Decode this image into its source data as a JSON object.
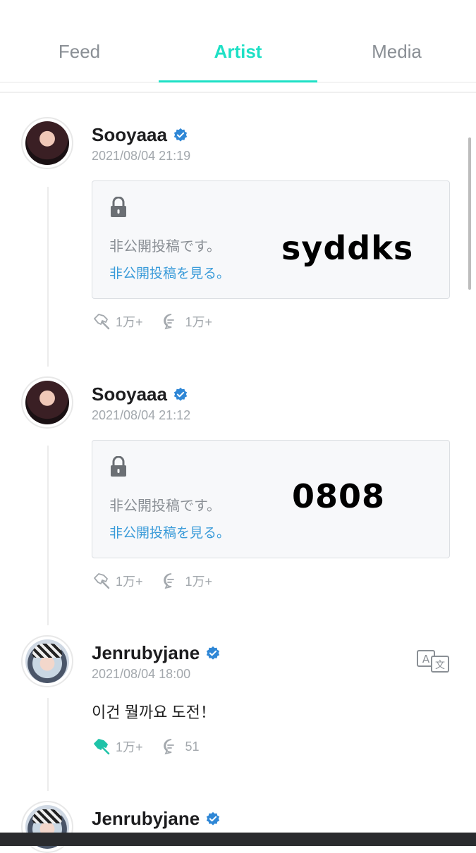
{
  "tabs": [
    {
      "label": "Feed",
      "active": false
    },
    {
      "label": "Artist",
      "active": true
    },
    {
      "label": "Media",
      "active": false
    }
  ],
  "colors": {
    "accent": "#1ee0c5",
    "link": "#3a9bd9",
    "verified": "#2f87d6"
  },
  "posts": [
    {
      "author": "Sooyaaa",
      "time": "2021/08/04 21:19",
      "private_text": "非公開投稿です。",
      "private_link": "非公開投稿を見る。",
      "overlay_text": "syddks",
      "likes": "1万+",
      "comments": "1万+"
    },
    {
      "author": "Sooyaaa",
      "time": "2021/08/04 21:12",
      "private_text": "非公開投稿です。",
      "private_link": "非公開投稿を見る。",
      "overlay_text": "0808",
      "likes": "1万+",
      "comments": "1万+"
    },
    {
      "author": "Jenrubyjane",
      "time": "2021/08/04 18:00",
      "text": "이건 뭘까요 도전！",
      "likes": "1万+",
      "comments": "51",
      "liked": true
    },
    {
      "author": "Jenrubyjane"
    }
  ],
  "icons": {
    "back": "chevron-left-icon",
    "verified": "verified-badge-icon",
    "lock": "lock-icon",
    "like": "lightstick-icon",
    "comment": "comment-icon",
    "translate": "translate-icon"
  }
}
